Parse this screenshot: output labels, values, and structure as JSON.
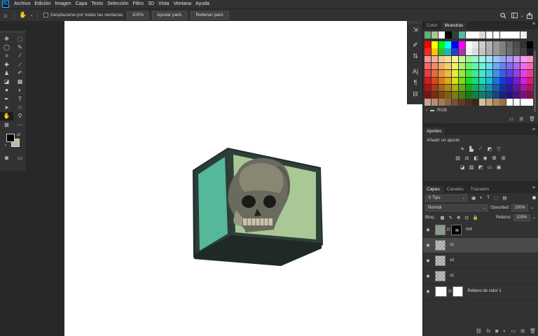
{
  "menubar": {
    "logo": "Ps",
    "items": [
      "Archivo",
      "Edición",
      "Imagen",
      "Capa",
      "Texto",
      "Selección",
      "Filtro",
      "3D",
      "Vista",
      "Ventana",
      "Ayuda"
    ]
  },
  "options": {
    "home_icon": "home-icon",
    "hand_icon": "hand-tool-icon",
    "scroll_all_label": "Desplazarse por todas las ventanas",
    "zoom_button": "100%",
    "fit_button": "Ajustar pant.",
    "fill_button": "Rellenar pant."
  },
  "toolbar": {
    "tools": [
      "move",
      "marquee",
      "lasso",
      "quick-select",
      "crop",
      "eyedropper",
      "healing",
      "brush",
      "stamp",
      "history-brush",
      "eraser",
      "gradient",
      "blur",
      "dodge",
      "pen",
      "type",
      "path-select",
      "shape",
      "hand",
      "zoom",
      "frame",
      "more"
    ],
    "foreground": "#000000",
    "background": "#a8c89a"
  },
  "swatches_panel": {
    "tabs": [
      "Color",
      "Muestras"
    ],
    "active_tab": "Muestras",
    "folder_label": "RGB"
  },
  "adjustments_panel": {
    "title": "Ajustes",
    "subtitle": "Añadir un ajuste"
  },
  "layers_panel": {
    "tabs": [
      "Capas",
      "Canales",
      "Trazados"
    ],
    "filter_label": "Tipo",
    "blend_mode": "Normal",
    "opacity_label": "Opacidad:",
    "opacity_value": "100%",
    "lock_label": "Bloq.:",
    "fill_label": "Relleno:",
    "fill_value": "100%",
    "layers": [
      {
        "name": "m4",
        "thumb": "photo",
        "mask": "black",
        "selected": false
      },
      {
        "name": "c1",
        "thumb": "checker",
        "mask": "none",
        "selected": true
      },
      {
        "name": "v2",
        "thumb": "checker",
        "mask": "none",
        "selected": false
      },
      {
        "name": "v1",
        "thumb": "checker",
        "mask": "none",
        "selected": false
      },
      {
        "name": "Relleno de color 1",
        "thumb": "white",
        "mask": "white",
        "selected": false
      }
    ]
  }
}
